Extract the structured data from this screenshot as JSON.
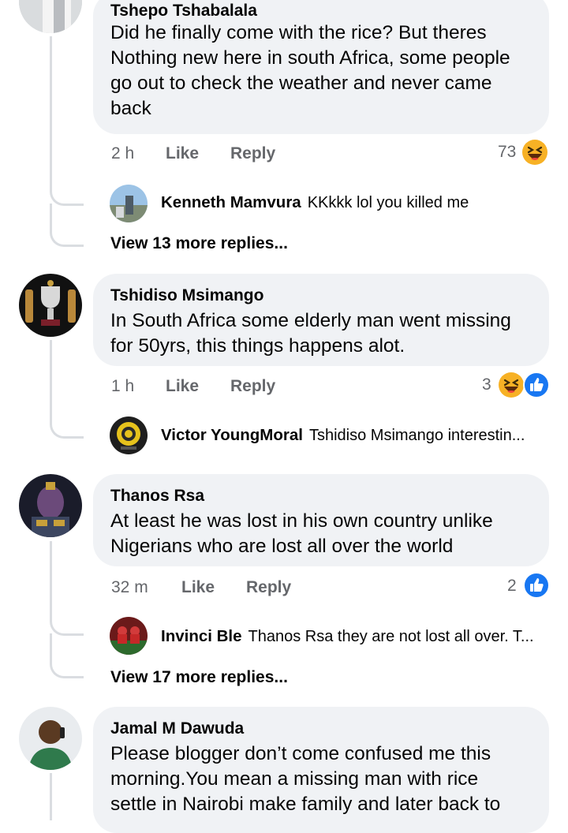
{
  "comments": [
    {
      "author": "Tshepo Tshabalala",
      "lines": [
        "Did he finally come with the rice? But theres",
        "Nothing new here in south Africa, some people",
        "go out to check the weather and never came",
        "back"
      ],
      "time": "2 h",
      "like_label": "Like",
      "reply_label": "Reply",
      "reaction_count": "73",
      "reactions": [
        "haha-emoji"
      ],
      "reply_preview": {
        "author": "Kenneth Mamvura",
        "text": "KKkkk lol you killed me"
      },
      "more_replies": "View 13 more replies..."
    },
    {
      "author": "Tshidiso Msimango",
      "lines": [
        "In South Africa some elderly man went missing",
        "for 50yrs, this things happens alot."
      ],
      "time": "1 h",
      "like_label": "Like",
      "reply_label": "Reply",
      "reaction_count": "3",
      "reactions": [
        "haha-emoji",
        "like-emoji"
      ],
      "reply_preview": {
        "author": "Victor YoungMoral",
        "text": "Tshidiso Msimango interestin..."
      }
    },
    {
      "author": "Thanos Rsa",
      "lines": [
        "At least he was lost in his own country unlike",
        "Nigerians who are lost all over the world"
      ],
      "time": "32 m",
      "like_label": "Like",
      "reply_label": "Reply",
      "reaction_count": "2",
      "reactions": [
        "like-emoji"
      ],
      "reply_preview": {
        "author": "Invinci Ble",
        "text": "Thanos Rsa they are not lost all over. T..."
      },
      "more_replies": "View 17 more replies..."
    },
    {
      "author": "Jamal M Dawuda",
      "lines": [
        "Please blogger don’t come confused me this",
        "morning.You mean a missing man with rice",
        "settle in Nairobi make family and later back to"
      ]
    }
  ],
  "colors": {
    "bubble_bg": "#f0f2f5",
    "secondary_text": "#65676b",
    "thread_line": "#dadde1",
    "like_blue": "#1877f2",
    "haha_yellow": "#f7b125"
  }
}
